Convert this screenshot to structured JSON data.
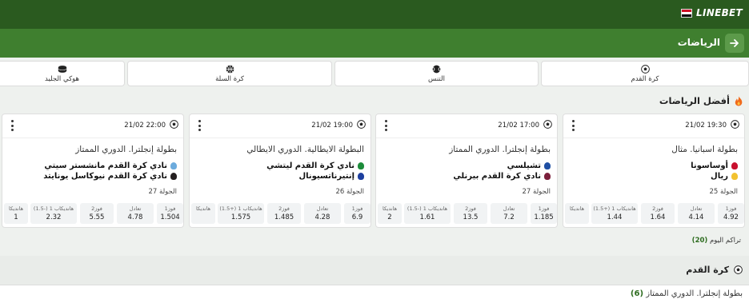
{
  "header": {
    "brand": "LINEBET",
    "flag_colors": [
      "#ce1126",
      "#ffffff",
      "#000000"
    ],
    "accent": "#2a5a1f"
  },
  "subheader": {
    "title": "الرياضات",
    "back_icon": "arrow-right-icon"
  },
  "sports": [
    {
      "label": "كرة القدم",
      "icon": "soccer-ball-icon"
    },
    {
      "label": "التنس",
      "icon": "tennis-ball-icon"
    },
    {
      "label": "كرة السلة",
      "icon": "basketball-icon"
    },
    {
      "label": "هوكي الجليد",
      "icon": "hockey-puck-icon"
    }
  ],
  "top_section": {
    "title": "أفضل الرياضات",
    "icon": "fire-icon"
  },
  "events": [
    {
      "time": "21/02 19:30",
      "league": "بطولة اسبانيا. مثال",
      "team1": "أوساسونا",
      "team2": "ريال",
      "round": "الجولة 25",
      "odds": [
        {
          "label": "فوز1",
          "value": "4.92"
        },
        {
          "label": "تعادل",
          "value": "4.14"
        },
        {
          "label": "فوز2",
          "value": "1.64"
        },
        {
          "label": "هانديكاب 1 (+1.5)",
          "value": "1.44"
        },
        {
          "label": "هانديكا",
          "value": ""
        }
      ]
    },
    {
      "time": "21/02 17:00",
      "league": "بطولة إنجلترا. الدوري الممتاز",
      "team1": "تشيلسي",
      "team2": "نادي كرة القدم بيرنلي",
      "round": "الجولة 27",
      "odds": [
        {
          "label": "فوز1",
          "value": "1.185"
        },
        {
          "label": "تعادل",
          "value": "7.2"
        },
        {
          "label": "فوز2",
          "value": "13.5"
        },
        {
          "label": "هانديكاب 1 (-1.5)",
          "value": "1.61"
        },
        {
          "label": "هانديكا",
          "value": "2"
        }
      ]
    },
    {
      "time": "21/02 19:00",
      "league": "البطولة الايطالية. الدوري الايطالي",
      "team1": "نادي كرة القدم ليتشي",
      "team2": "إنتيرناتسيونال",
      "round": "الجولة 26",
      "odds": [
        {
          "label": "فوز1",
          "value": "6.9"
        },
        {
          "label": "تعادل",
          "value": "4.28"
        },
        {
          "label": "فوز2",
          "value": "1.485"
        },
        {
          "label": "هانديكاب 1 (+1.5)",
          "value": "1.575"
        },
        {
          "label": "هانديكا",
          "value": ""
        }
      ]
    },
    {
      "time": "21/02 22:00",
      "league": "بطولة إنجلترا. الدوري الممتاز",
      "team1": "نادي كرة القدم مانشستر سيتي",
      "team2": "نادي كرة القدم نيوكاسل يونايتد",
      "round": "الجولة 27",
      "odds": [
        {
          "label": "فوز1",
          "value": "1.504"
        },
        {
          "label": "تعادل",
          "value": "4.78"
        },
        {
          "label": "فوز2",
          "value": "5.55"
        },
        {
          "label": "هانديكاب 1 (-1.5)",
          "value": "2.32"
        },
        {
          "label": "هانديكا",
          "value": "1"
        }
      ]
    }
  ],
  "accumulator": {
    "label": "تراكم اليوم",
    "count": "(20)"
  },
  "football_section": {
    "title": "كرة القدم",
    "icon": "soccer-ball-icon"
  },
  "league_row": {
    "label": "بطولة إنجلترا. الدوري الممتاز",
    "count": "(6)"
  }
}
